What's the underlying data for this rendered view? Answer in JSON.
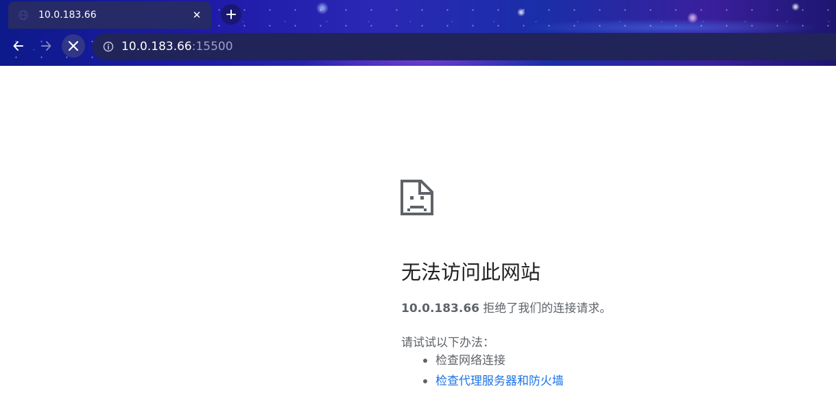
{
  "browser": {
    "tab": {
      "title": "10.0.183.66",
      "favicon": "globe-icon",
      "close_label": "✕"
    },
    "new_tab_icon": "plus-icon",
    "nav": {
      "back_icon": "arrow-left-icon",
      "forward_icon": "arrow-right-icon",
      "stop_icon": "close-icon"
    },
    "address_bar": {
      "info_icon": "info-icon",
      "host": "10.0.183.66",
      "port": ":15500"
    },
    "colors": {
      "tab_bg": "#262a66",
      "omnibox_bg": "#202458"
    }
  },
  "error_page": {
    "icon": "sad-document-icon",
    "title": "无法访问此网站",
    "host": "10.0.183.66",
    "message": " 拒绝了我们的连接请求。",
    "suggestions_heading": "请试试以下办法：",
    "suggestions": [
      {
        "label": "检查网络连接",
        "is_link": false
      },
      {
        "label": "检查代理服务器和防火墙",
        "is_link": true
      }
    ],
    "colors": {
      "text": "#5f6368",
      "title": "#202124",
      "link": "#1a73e8"
    }
  }
}
